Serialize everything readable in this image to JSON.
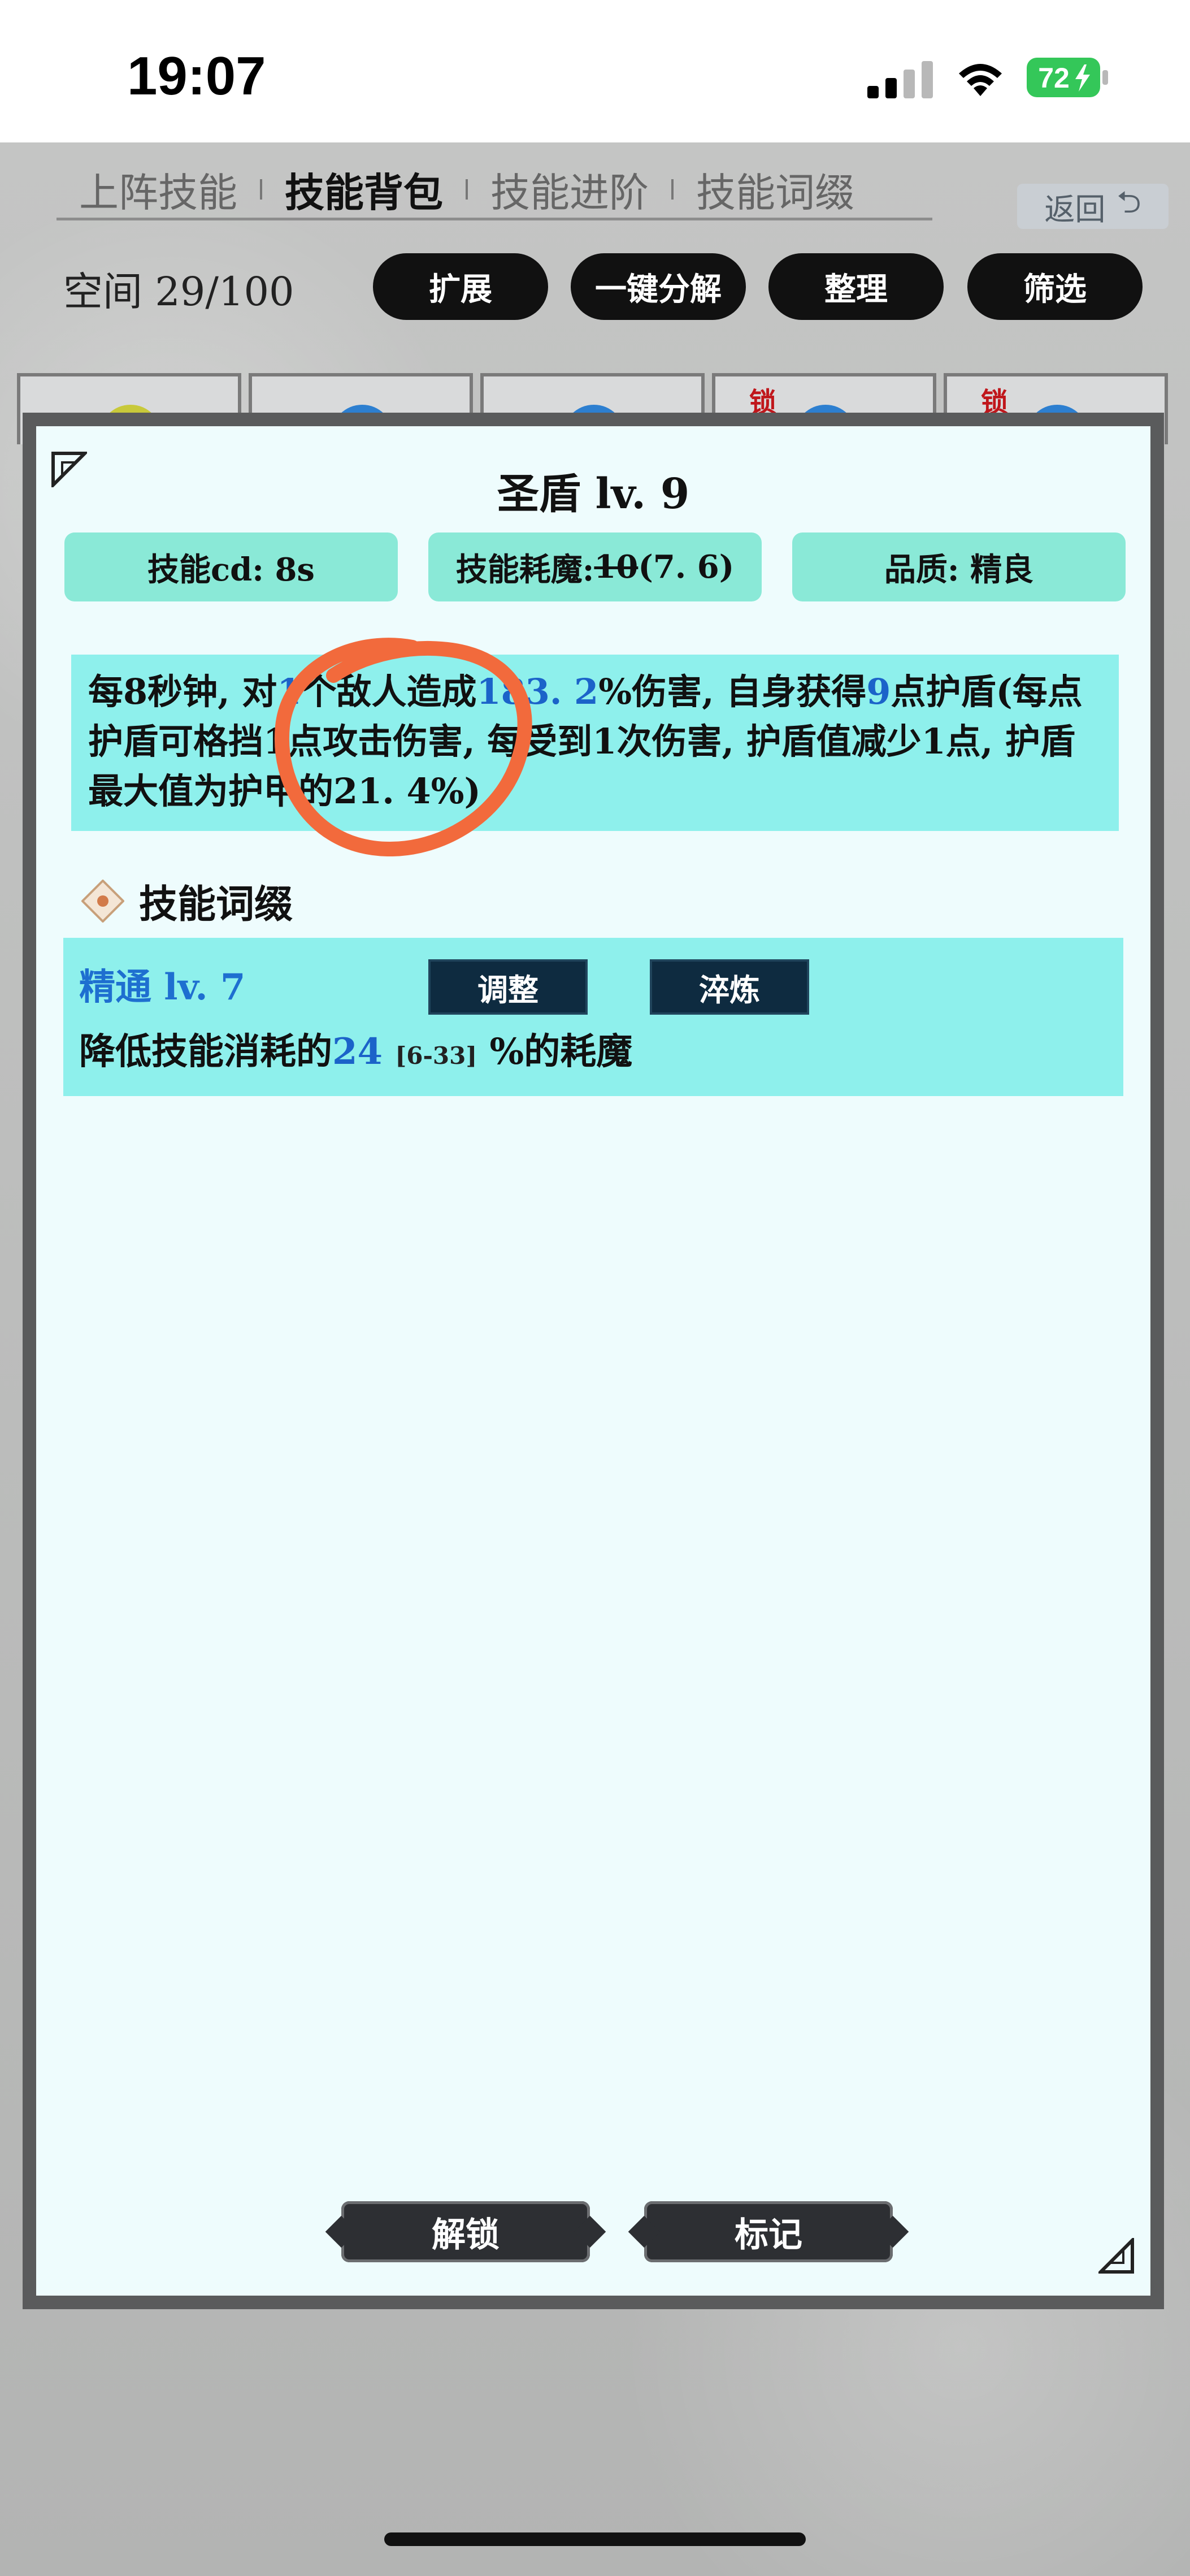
{
  "status_bar": {
    "time": "19:07",
    "battery": "72"
  },
  "tabs": [
    {
      "label": "上阵技能"
    },
    {
      "label": "技能背包"
    },
    {
      "label": "技能进阶"
    },
    {
      "label": "技能词缀"
    }
  ],
  "back_label": "返回",
  "space_label": "空间  29/100",
  "toolbar": {
    "expand": "扩展",
    "decompose": "一键分解",
    "sort": "整理",
    "filter": "筛选"
  },
  "slots": {
    "lock_label": "锁"
  },
  "skill": {
    "name": "圣盾  lv. 9",
    "cd_label": "技能cd:  8s",
    "mana_label": "技能耗魔:",
    "mana_old": "10",
    "mana_new": "(7. 6)",
    "quality_label": "品质:  精良",
    "desc": {
      "p1": "每8秒钟, 对",
      "n1": "1",
      "p2": "个敌人造成",
      "n2": "183. 2",
      "p3": "%伤害, 自身获得",
      "n3": "9",
      "p4": "点护盾(每点护盾可格挡1点攻击伤害, 每受到1次伤害, 护盾值减少1点, 护盾最大值为护甲的21. 4%)"
    }
  },
  "affix_section": {
    "title": "技能词缀"
  },
  "affix": {
    "name": "精通  lv. 7",
    "adjust_label": "调整",
    "refine_label": "淬炼",
    "desc_prefix": "降低技能消耗的",
    "value": "24",
    "range": "[6-33]",
    "desc_suffix": "%的耗魔"
  },
  "buttons": {
    "unlock": "解锁",
    "mark": "标记"
  },
  "colors": {
    "stat_bg": "#8ae9d7",
    "desc_bg": "#8ef0ec",
    "highlight": "#1b63c9",
    "annotation": "#f26a3c"
  }
}
